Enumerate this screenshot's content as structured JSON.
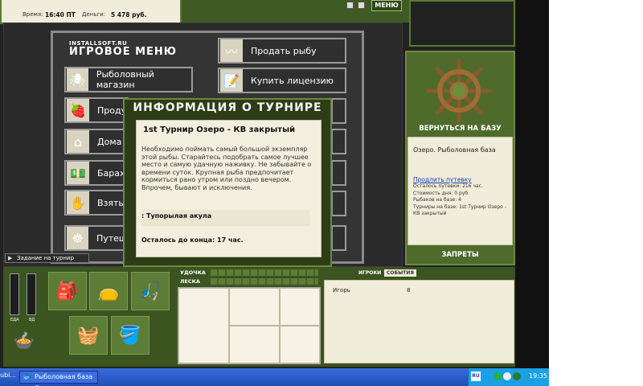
{
  "status": {
    "time_label": "Время:",
    "time_value": "16:40 ПТ",
    "money_label": "Деньги:",
    "money_value": "5 478 руб."
  },
  "header": {
    "menu_button": "МЕНЮ"
  },
  "menu": {
    "brand_small": "INSTALLSOFT.RU",
    "brand_big": "ИГРОВОЕ МЕНЮ",
    "left_items": [
      {
        "label": "Рыболовный магазин",
        "icon": "bug-icon"
      },
      {
        "label": "Проду",
        "icon": "berries-icon"
      },
      {
        "label": "Дома",
        "icon": "house-icon"
      },
      {
        "label": "Барах",
        "icon": "money-icon"
      },
      {
        "label": "Взять",
        "icon": "hand-icon"
      },
      {
        "label": "Путеш",
        "icon": "wheel-icon"
      }
    ],
    "right_items": [
      {
        "label": "Продать рыбу",
        "icon": "worm-icon"
      },
      {
        "label": "Купить лицензию",
        "icon": "document-icon"
      }
    ]
  },
  "dialog": {
    "title": "ИНФОРМАЦИЯ О ТУРНИРЕ",
    "tournament_name": "1st Турнир Озеро - КВ закрытый",
    "description": "Необходимо поймать самый большой экземпляр этой рыбы. Старайтесь подобрать самое лучшее место и самую удачную наживку. Не забывайте о времени суток. Крупная рыба предпочитает кормиться рано утром или поздно вечером. Впрочем, бывают и исключения.",
    "fish": ": Тупорылая акула",
    "remaining": "Осталось до конца: 17 час."
  },
  "task_bar": {
    "label": "Задание на турнир"
  },
  "right": {
    "back_button": "ВЕРНУТЬСЯ НА БАЗУ",
    "base_title": "Озеро. Рыболовная база",
    "extend_link": "Продлить путевку",
    "info_lines": [
      "Осталось путевки: 216 час.",
      "Стоимость дня: 0 руб.",
      "Рыбаков на базе: 4",
      "Турниры на базе: 1st Турнир Озеро - КВ закрытый"
    ],
    "ban_button": "ЗАПРЕТЫ"
  },
  "bottom": {
    "food_label": "ЕДА",
    "drink_label": "ВД",
    "rod_label": "УДОЧКА",
    "line_label": "ЛЕСКА",
    "tab_players": "ИГРОКИ",
    "tab_events": "СОБЫТИЯ",
    "player_name": "Игорь",
    "player_score": "8"
  },
  "taskbar": {
    "left_text": "ubi...",
    "task_title": "Рыболовная база Оз...",
    "lang": "RU",
    "clock": "19:35"
  }
}
